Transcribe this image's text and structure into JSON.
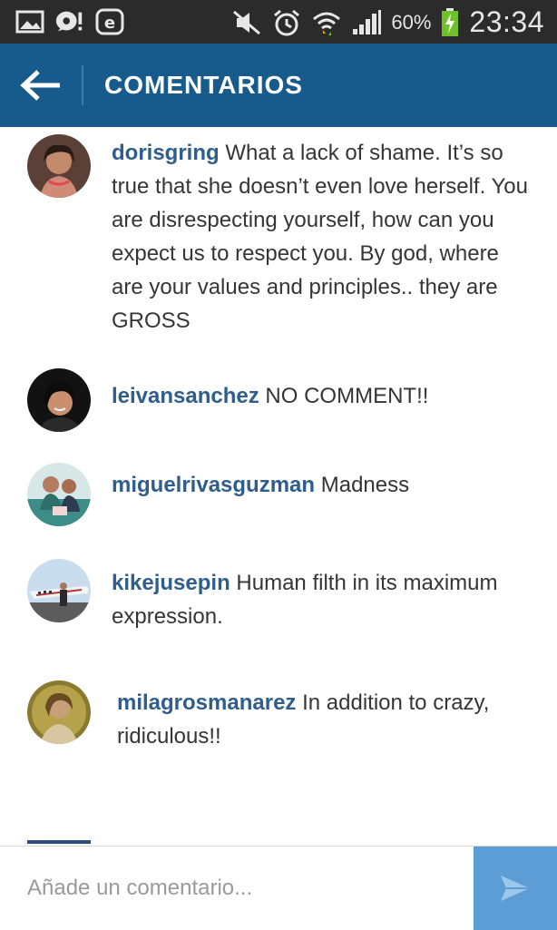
{
  "status": {
    "battery": "60%",
    "time": "23:34"
  },
  "header": {
    "title": "COMENTARIOS"
  },
  "comments": [
    {
      "user": "dorisgring",
      "text": "What a lack of shame. It’s so true that she doesn’t even love herself. You are disrespecting yourself, how can you expect us to respect you. By god, where are your values and principles.. they are GROSS"
    },
    {
      "user": "leivansanchez",
      "text": "NO COMMENT!!"
    },
    {
      "user": "miguelrivasguzman",
      "text": "Madness"
    },
    {
      "user": "kikejusepin",
      "text": "Human filth in its maximum expression."
    },
    {
      "user": "milagrosmanarez",
      "text": "In addition to crazy, ridiculous!!"
    }
  ],
  "composer": {
    "placeholder": "Añade un comentario..."
  },
  "colors": {
    "appbar": "#175a8c",
    "username": "#2f5d8c",
    "send": "#5b9dd4",
    "statusbar": "#2b2b2b"
  }
}
